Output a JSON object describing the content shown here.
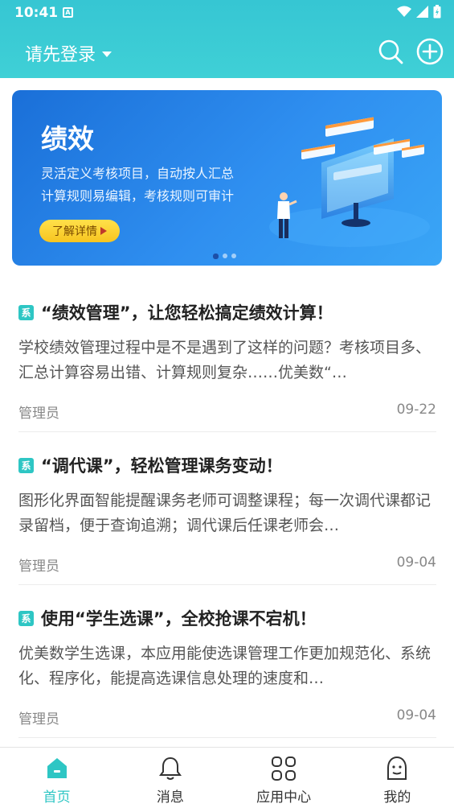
{
  "status_bar": {
    "time": "10:41",
    "notif_glyph": "A"
  },
  "header": {
    "login_label": "请先登录"
  },
  "banner": {
    "title": "绩效",
    "line1": "灵活定义考核项目，自动按人汇总",
    "line2": "计算规则易编辑，考核规则可审计",
    "button_label": "了解详情",
    "dots": 3,
    "active_dot": 0
  },
  "articles": [
    {
      "tag": "系",
      "title": "“绩效管理”，让您轻松搞定绩效计算！",
      "summary": "学校绩效管理过程中是不是遇到了这样的问题？考核项目多、汇总计算容易出错、计算规则复杂……优美数“…",
      "author": "管理员",
      "date": "09-22"
    },
    {
      "tag": "系",
      "title": "“调代课”，轻松管理课务变动！",
      "summary": "图形化界面智能提醒课务老师可调整课程；每一次调代课都记录留档，便于查询追溯；调代课后任课老师会…",
      "author": "管理员",
      "date": "09-04"
    },
    {
      "tag": "系",
      "title": "使用“学生选课”，全校抢课不宕机！",
      "summary": "优美数学生选课，本应用能使选课管理工作更加规范化、系统化、程序化，能提高选课信息处理的速度和…",
      "author": "管理员",
      "date": "09-04"
    }
  ],
  "tabs": [
    {
      "label": "首页",
      "icon": "home-icon",
      "active": true
    },
    {
      "label": "消息",
      "icon": "bell-icon",
      "active": false
    },
    {
      "label": "应用中心",
      "icon": "grid-icon",
      "active": false
    },
    {
      "label": "我的",
      "icon": "person-icon",
      "active": false
    }
  ],
  "colors": {
    "header": "#3fcdd4",
    "accent": "#2ec6c4",
    "banner": "#2f8ff0",
    "button": "#f7c520"
  }
}
